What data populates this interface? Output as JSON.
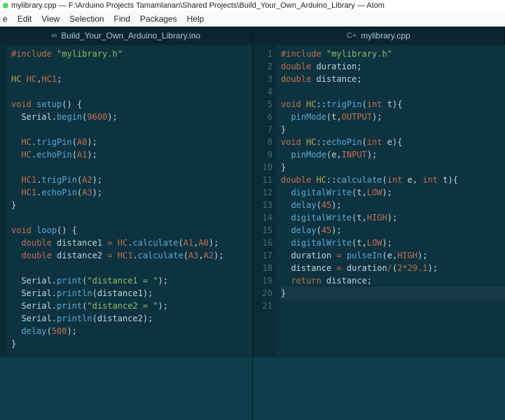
{
  "window": {
    "title": "mylibrary.cpp — F:\\Arduino Projects Tamamlanan\\Shared Projects\\Build_Your_Own_Arduino_Library — Atom"
  },
  "menu": {
    "items": [
      "e",
      "Edit",
      "View",
      "Selection",
      "Find",
      "Packages",
      "Help"
    ]
  },
  "tabs": {
    "left": {
      "icon": "∞",
      "label": "Build_Your_Own_Arduino_Library.ino"
    },
    "right": {
      "icon": "C+",
      "label": "mylibrary.cpp"
    }
  },
  "left_pane": {
    "lines": [
      [
        [
          "#include",
          "pre"
        ],
        [
          " ",
          "sep"
        ],
        [
          "\"mylibrary.h\"",
          "str"
        ]
      ],
      [],
      [
        [
          "HC",
          "type"
        ],
        [
          " ",
          "sep"
        ],
        [
          "HC",
          "hc"
        ],
        [
          ",",
          "sep"
        ],
        [
          "HC1",
          "hc"
        ],
        [
          ";",
          "sep"
        ]
      ],
      [],
      [
        [
          "void",
          "kw"
        ],
        [
          " ",
          "sep"
        ],
        [
          "setup",
          "fn"
        ],
        [
          "() {",
          "paren"
        ]
      ],
      [
        [
          "  Serial",
          "ident"
        ],
        [
          ".",
          "sep"
        ],
        [
          "begin",
          "fn"
        ],
        [
          "(",
          "paren"
        ],
        [
          "9600",
          "num"
        ],
        [
          ");",
          "paren"
        ]
      ],
      [],
      [
        [
          "  HC",
          "hc"
        ],
        [
          ".",
          "sep"
        ],
        [
          "trigPin",
          "fn"
        ],
        [
          "(",
          "paren"
        ],
        [
          "A0",
          "const"
        ],
        [
          ");",
          "paren"
        ]
      ],
      [
        [
          "  HC",
          "hc"
        ],
        [
          ".",
          "sep"
        ],
        [
          "echoPin",
          "fn"
        ],
        [
          "(",
          "paren"
        ],
        [
          "A1",
          "const"
        ],
        [
          ");",
          "paren"
        ]
      ],
      [],
      [
        [
          "  HC1",
          "hc"
        ],
        [
          ".",
          "sep"
        ],
        [
          "trigPin",
          "fn"
        ],
        [
          "(",
          "paren"
        ],
        [
          "A2",
          "const"
        ],
        [
          ");",
          "paren"
        ]
      ],
      [
        [
          "  HC1",
          "hc"
        ],
        [
          ".",
          "sep"
        ],
        [
          "echoPin",
          "fn"
        ],
        [
          "(",
          "paren"
        ],
        [
          "A3",
          "const"
        ],
        [
          ");",
          "paren"
        ]
      ],
      [
        [
          "}",
          "paren"
        ]
      ],
      [],
      [
        [
          "void",
          "kw"
        ],
        [
          " ",
          "sep"
        ],
        [
          "loop",
          "fn"
        ],
        [
          "() {",
          "paren"
        ]
      ],
      [
        [
          "  double",
          "kw"
        ],
        [
          " distance1 ",
          "ident"
        ],
        [
          "=",
          "op"
        ],
        [
          " ",
          "sep"
        ],
        [
          "HC",
          "hc"
        ],
        [
          ".",
          "sep"
        ],
        [
          "calculate",
          "fn"
        ],
        [
          "(",
          "paren"
        ],
        [
          "A1",
          "const"
        ],
        [
          ",",
          "sep"
        ],
        [
          "A0",
          "const"
        ],
        [
          ");",
          "paren"
        ]
      ],
      [
        [
          "  double",
          "kw"
        ],
        [
          " distance2 ",
          "ident"
        ],
        [
          "=",
          "op"
        ],
        [
          " ",
          "sep"
        ],
        [
          "HC1",
          "hc"
        ],
        [
          ".",
          "sep"
        ],
        [
          "calculate",
          "fn"
        ],
        [
          "(",
          "paren"
        ],
        [
          "A3",
          "const"
        ],
        [
          ",",
          "sep"
        ],
        [
          "A2",
          "const"
        ],
        [
          ");",
          "paren"
        ]
      ],
      [],
      [
        [
          "  Serial",
          "ident"
        ],
        [
          ".",
          "sep"
        ],
        [
          "print",
          "fn"
        ],
        [
          "(",
          "paren"
        ],
        [
          "\"distance1 = \"",
          "str"
        ],
        [
          ");",
          "paren"
        ]
      ],
      [
        [
          "  Serial",
          "ident"
        ],
        [
          ".",
          "sep"
        ],
        [
          "println",
          "fn"
        ],
        [
          "(distance1);",
          "paren"
        ]
      ],
      [
        [
          "  Serial",
          "ident"
        ],
        [
          ".",
          "sep"
        ],
        [
          "print",
          "fn"
        ],
        [
          "(",
          "paren"
        ],
        [
          "\"distance2 = \"",
          "str"
        ],
        [
          ");",
          "paren"
        ]
      ],
      [
        [
          "  Serial",
          "ident"
        ],
        [
          ".",
          "sep"
        ],
        [
          "println",
          "fn"
        ],
        [
          "(distance2);",
          "paren"
        ]
      ],
      [
        [
          "  delay",
          "fn"
        ],
        [
          "(",
          "paren"
        ],
        [
          "500",
          "num"
        ],
        [
          ");",
          "paren"
        ]
      ],
      [
        [
          "}",
          "paren"
        ]
      ]
    ]
  },
  "right_pane": {
    "line_numbers": [
      "1",
      "2",
      "3",
      "4",
      "5",
      "6",
      "7",
      "8",
      "9",
      "10",
      "11",
      "12",
      "13",
      "14",
      "15",
      "16",
      "17",
      "18",
      "19",
      "20",
      "21"
    ],
    "cursor_line": 20,
    "lines": [
      [
        [
          "#include",
          "pre"
        ],
        [
          " ",
          "sep"
        ],
        [
          "\"mylibrary.h\"",
          "str"
        ]
      ],
      [
        [
          "double",
          "kw"
        ],
        [
          " duration;",
          "ident"
        ]
      ],
      [
        [
          "double",
          "kw"
        ],
        [
          " distance;",
          "ident"
        ]
      ],
      [],
      [
        [
          "void",
          "kw"
        ],
        [
          " HC",
          "type"
        ],
        [
          "::",
          "sep"
        ],
        [
          "trigPin",
          "fn"
        ],
        [
          "(",
          "paren"
        ],
        [
          "int",
          "kw"
        ],
        [
          " t){",
          "paren"
        ]
      ],
      [
        [
          "  pinMode",
          "fn"
        ],
        [
          "(t,",
          "paren"
        ],
        [
          "OUTPUT",
          "const"
        ],
        [
          ");",
          "paren"
        ]
      ],
      [
        [
          "}",
          "paren"
        ]
      ],
      [
        [
          "void",
          "kw"
        ],
        [
          " HC",
          "type"
        ],
        [
          "::",
          "sep"
        ],
        [
          "echoPin",
          "fn"
        ],
        [
          "(",
          "paren"
        ],
        [
          "int",
          "kw"
        ],
        [
          " e){",
          "paren"
        ]
      ],
      [
        [
          "  pinMode",
          "fn"
        ],
        [
          "(e,",
          "paren"
        ],
        [
          "INPUT",
          "const"
        ],
        [
          ");",
          "paren"
        ]
      ],
      [
        [
          "}",
          "paren"
        ]
      ],
      [
        [
          "double",
          "kw"
        ],
        [
          " HC",
          "type"
        ],
        [
          "::",
          "sep"
        ],
        [
          "calculate",
          "fn"
        ],
        [
          "(",
          "paren"
        ],
        [
          "int",
          "kw"
        ],
        [
          " e, ",
          "paren"
        ],
        [
          "int",
          "kw"
        ],
        [
          " t){",
          "paren"
        ]
      ],
      [
        [
          "  digitalWrite",
          "fn"
        ],
        [
          "(t,",
          "paren"
        ],
        [
          "LOW",
          "const"
        ],
        [
          ");",
          "paren"
        ]
      ],
      [
        [
          "  delay",
          "fn"
        ],
        [
          "(",
          "paren"
        ],
        [
          "45",
          "num"
        ],
        [
          ");",
          "paren"
        ]
      ],
      [
        [
          "  digitalWrite",
          "fn"
        ],
        [
          "(t,",
          "paren"
        ],
        [
          "HIGH",
          "const"
        ],
        [
          ");",
          "paren"
        ]
      ],
      [
        [
          "  delay",
          "fn"
        ],
        [
          "(",
          "paren"
        ],
        [
          "45",
          "num"
        ],
        [
          ");",
          "paren"
        ]
      ],
      [
        [
          "  digitalWrite",
          "fn"
        ],
        [
          "(t,",
          "paren"
        ],
        [
          "LOW",
          "const"
        ],
        [
          ");",
          "paren"
        ]
      ],
      [
        [
          "  duration ",
          "ident"
        ],
        [
          "=",
          "op"
        ],
        [
          " ",
          "sep"
        ],
        [
          "pulseIn",
          "fn"
        ],
        [
          "(e,",
          "paren"
        ],
        [
          "HIGH",
          "const"
        ],
        [
          ");",
          "paren"
        ]
      ],
      [
        [
          "  distance ",
          "ident"
        ],
        [
          "=",
          "op"
        ],
        [
          " duration",
          "ident"
        ],
        [
          "/",
          "op"
        ],
        [
          "(",
          "paren"
        ],
        [
          "2",
          "num"
        ],
        [
          "*",
          "op"
        ],
        [
          "29.1",
          "num"
        ],
        [
          ");",
          "paren"
        ]
      ],
      [
        [
          "  return",
          "kw"
        ],
        [
          " distance;",
          "ident"
        ]
      ],
      [
        [
          "}",
          "paren"
        ]
      ],
      []
    ]
  }
}
